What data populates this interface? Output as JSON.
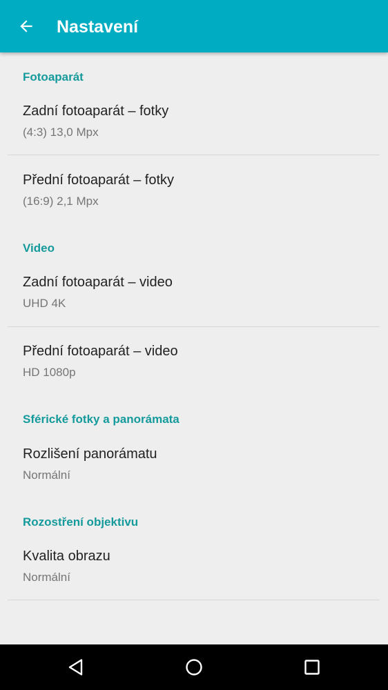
{
  "appbar": {
    "title": "Nastavení",
    "back_icon": "arrow-back-icon",
    "background": "#00acc1"
  },
  "sections": [
    {
      "header": "Fotoaparát",
      "items": [
        {
          "title": "Zadní fotoaparát – fotky",
          "summary": "(4:3) 13,0 Mpx"
        },
        {
          "title": "Přední fotoaparát – fotky",
          "summary": "(16:9) 2,1 Mpx"
        }
      ]
    },
    {
      "header": "Video",
      "items": [
        {
          "title": "Zadní fotoaparát – video",
          "summary": "UHD 4K"
        },
        {
          "title": "Přední fotoaparát – video",
          "summary": "HD 1080p"
        }
      ]
    },
    {
      "header": "Sférické fotky a panorámata",
      "items": [
        {
          "title": "Rozlišení panorámatu",
          "summary": "Normální"
        }
      ]
    },
    {
      "header": "Rozostření objektivu",
      "items": [
        {
          "title": "Kvalita obrazu",
          "summary": "Normální"
        }
      ]
    }
  ],
  "navbar": {
    "back_icon": "nav-back-triangle-icon",
    "home_icon": "nav-home-circle-icon",
    "recents_icon": "nav-recents-square-icon"
  },
  "colors": {
    "accent": "#159a9c",
    "background": "#eeeeee",
    "title_text": "#212121",
    "summary_text": "#757575"
  }
}
